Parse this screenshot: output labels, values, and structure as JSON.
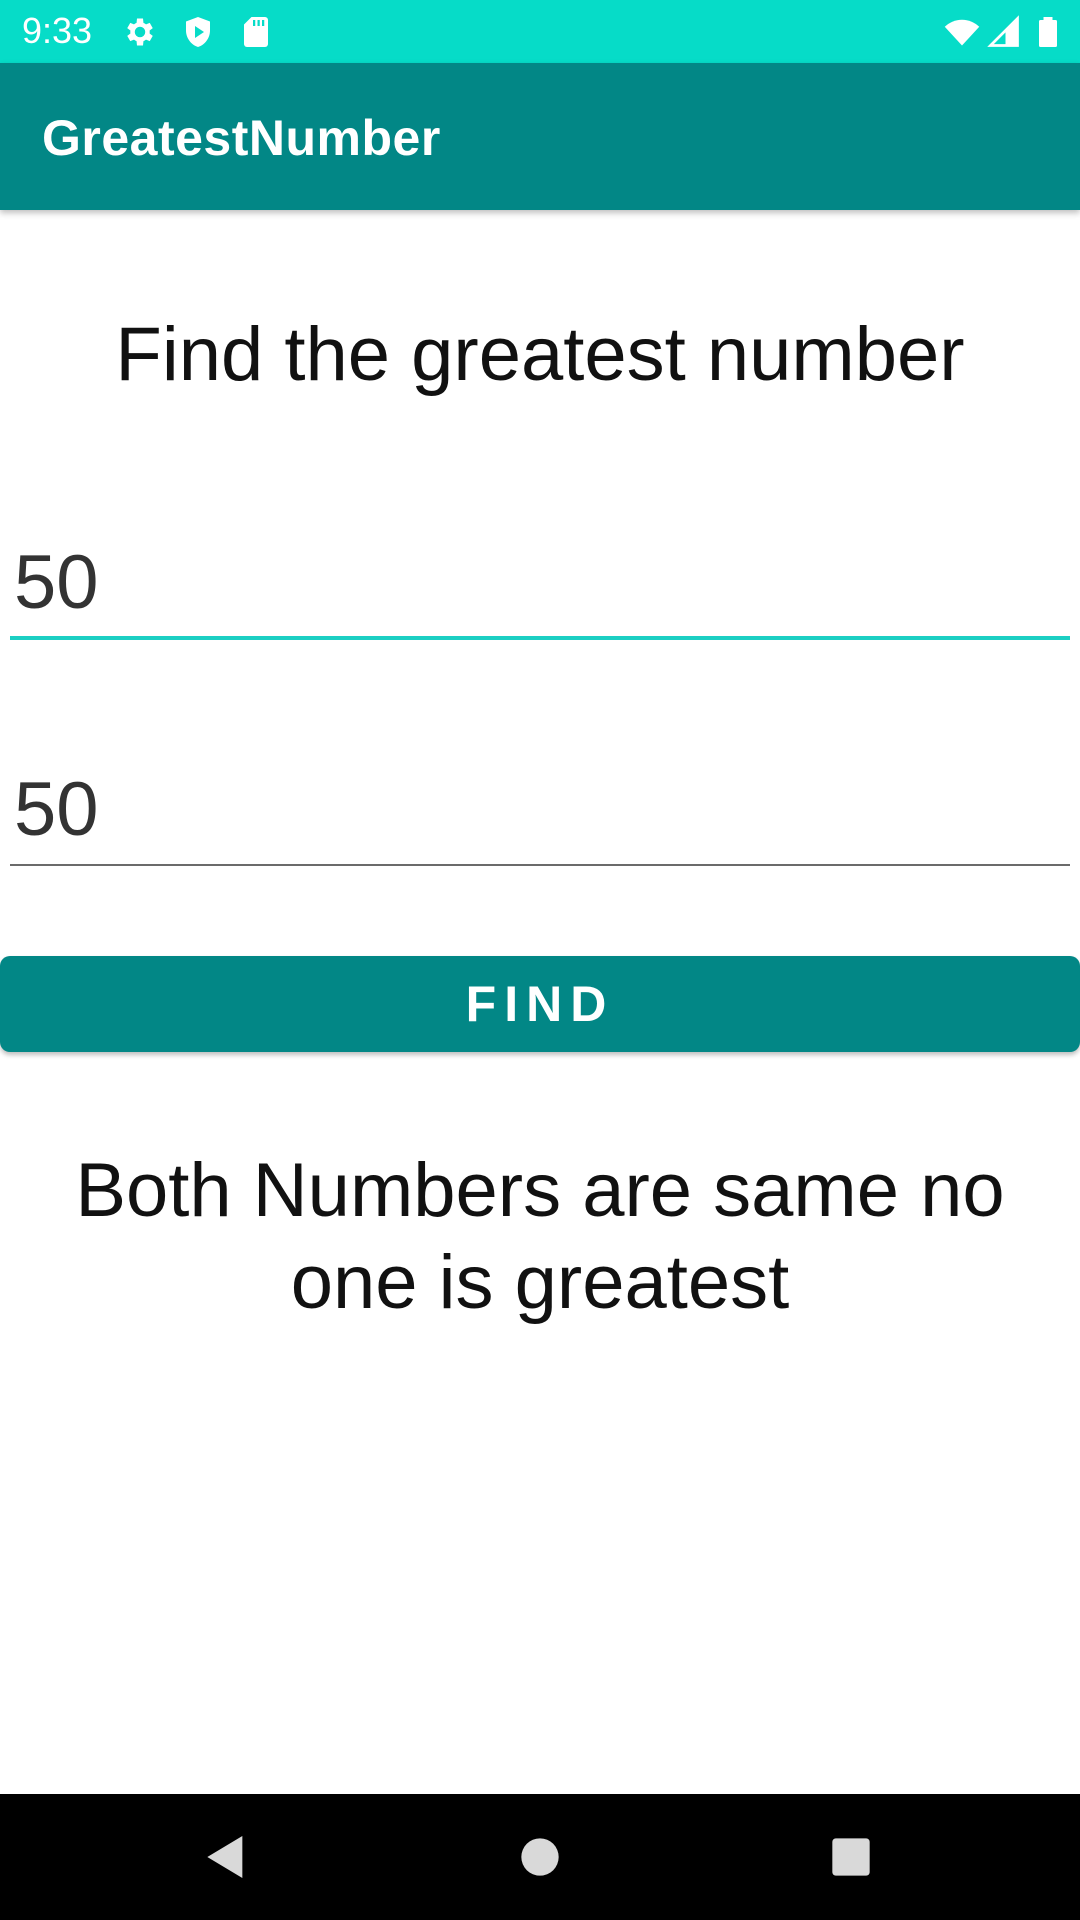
{
  "status_bar": {
    "time": "9:33",
    "icons": [
      "gear-icon",
      "shield-play-icon",
      "sd-card-icon",
      "wifi-icon",
      "signal-icon",
      "battery-icon"
    ],
    "background_color": "#06dcc8"
  },
  "app_bar": {
    "title": "GreatestNumber",
    "background_color": "#028786"
  },
  "main": {
    "heading": "Find the greatest number",
    "first_number": {
      "value": "50",
      "focused": true,
      "underline_color": "#1ccfc3"
    },
    "second_number": {
      "value": "50",
      "focused": false,
      "underline_color": "#6b6b6b"
    },
    "find_button_label": "FIND",
    "result_text": "Both Numbers are same no one is greatest"
  },
  "nav_bar": {
    "icons": [
      "back-icon",
      "home-icon",
      "recents-icon"
    ]
  }
}
